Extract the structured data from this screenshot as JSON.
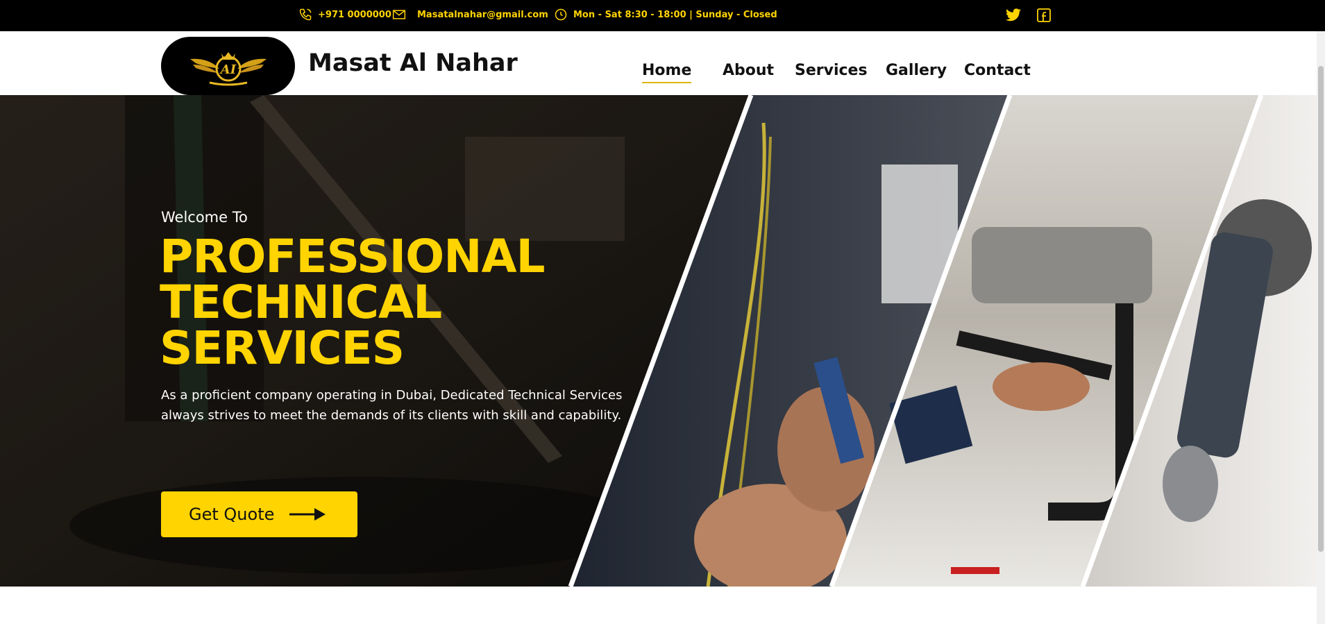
{
  "topbar": {
    "phone": "+971 0000000",
    "email": "Masatalnahar@gmail.com",
    "hours": "Mon - Sat 8:30 - 18:00 | Sunday - Closed",
    "icons": [
      "phone-icon",
      "mail-icon",
      "clock-icon",
      "twitter-icon",
      "facebook-icon"
    ]
  },
  "header": {
    "logo_text": "AI",
    "brand": "Masat Al Nahar",
    "nav": [
      "Home",
      "About",
      "Services",
      "Gallery",
      "Contact"
    ],
    "active_nav": "Home"
  },
  "hero": {
    "subtitle": "Welcome To",
    "title_lines": [
      "PROFESSIONAL",
      "TECHNICAL",
      "SERVICES"
    ],
    "description": "As a proficient company operating in Dubai, Dedicated Technical Services always strives to meet the demands of its clients with skill and capability.",
    "cta": "Get Quote"
  },
  "colors": {
    "accent": "#FFD400",
    "topbar_bg": "#000000",
    "text_dark": "#111111"
  }
}
